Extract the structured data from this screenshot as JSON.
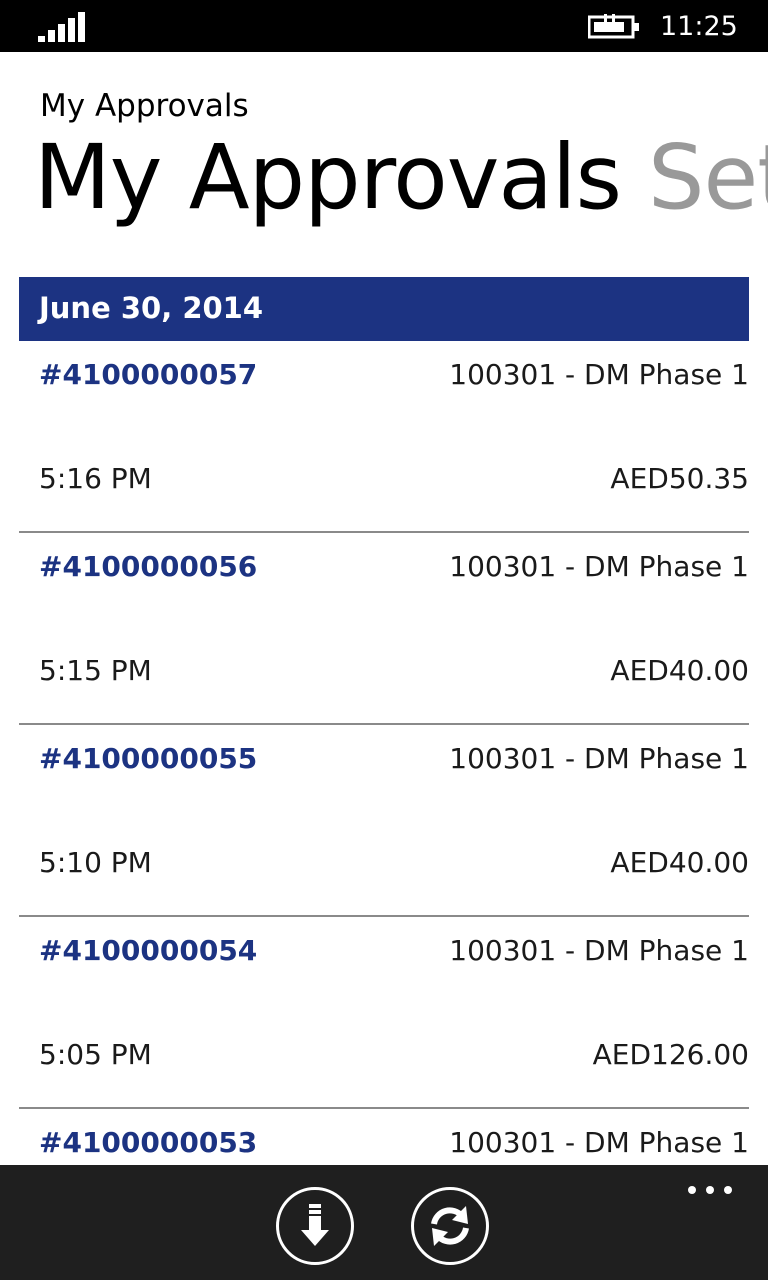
{
  "status_bar": {
    "time": "11:25",
    "signal_icon": "signal-strength-icon",
    "battery_icon": "battery-charging-icon"
  },
  "header": {
    "app_title": "My Approvals",
    "pivot": {
      "active": "My Approvals",
      "next": "Set"
    }
  },
  "list": {
    "group_date": "June 30, 2014",
    "items": [
      {
        "id": "#4100000057",
        "project": "100301 - DM Phase 1",
        "time": "5:16 PM",
        "amount": "AED50.35"
      },
      {
        "id": "#4100000056",
        "project": "100301 - DM Phase 1",
        "time": "5:15 PM",
        "amount": "AED40.00"
      },
      {
        "id": "#4100000055",
        "project": "100301 - DM Phase 1",
        "time": "5:10 PM",
        "amount": "AED40.00"
      },
      {
        "id": "#4100000054",
        "project": "100301 - DM Phase 1",
        "time": "5:05 PM",
        "amount": "AED126.00"
      },
      {
        "id": "#4100000053",
        "project": "100301 - DM Phase 1",
        "time": "",
        "amount": ""
      }
    ]
  },
  "app_bar": {
    "buttons": [
      {
        "icon": "download-icon"
      },
      {
        "icon": "refresh-icon"
      }
    ],
    "more_icon": "more-ellipsis-icon"
  },
  "colors": {
    "accent": "#1c3382",
    "status_bar_bg": "#000000",
    "app_bar_bg": "#1f1f1f",
    "pivot_inactive": "#999999",
    "divider": "#8a8a8a"
  }
}
